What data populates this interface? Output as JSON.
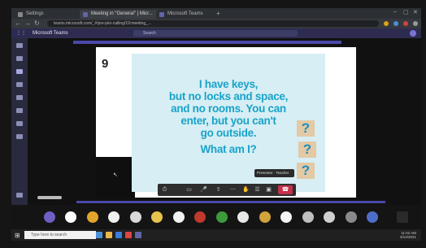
{
  "browser": {
    "tabs": [
      {
        "label": "Settings"
      },
      {
        "label": "Meeting in \"General\" | Micr..."
      },
      {
        "label": "Microsoft Teams"
      }
    ],
    "new_tab": "+",
    "url": "teams.microsoft.com/_#/pre-join-calling/19:meeting_..."
  },
  "teams": {
    "app_name": "Microsoft Teams",
    "search_placeholder": "Search"
  },
  "slide": {
    "number": "9",
    "riddle_lines": [
      "I have keys,",
      "but no locks and space,",
      "and no rooms. You can",
      "enter, but you can't",
      "go outside.",
      "What am I?"
    ],
    "question_marks": [
      "?",
      "?",
      "?"
    ],
    "presenter_tag": "Presenter · Teacher"
  },
  "controls": {
    "items": [
      "⏱",
      "▭",
      "🎤",
      "⇪",
      "⋯",
      "✋",
      "☰",
      "▣"
    ],
    "hangup": "☎"
  },
  "taskbar": {
    "start": "⊞",
    "search_placeholder": "Type here to search",
    "clock_time": "11:02 AM",
    "clock_date": "3/12/2021"
  },
  "colors": {
    "riddle_text": "#19a3c8",
    "card_bg": "#d6eef4",
    "teams_purple": "#2d2c50",
    "hangup_red": "#c4314b"
  }
}
